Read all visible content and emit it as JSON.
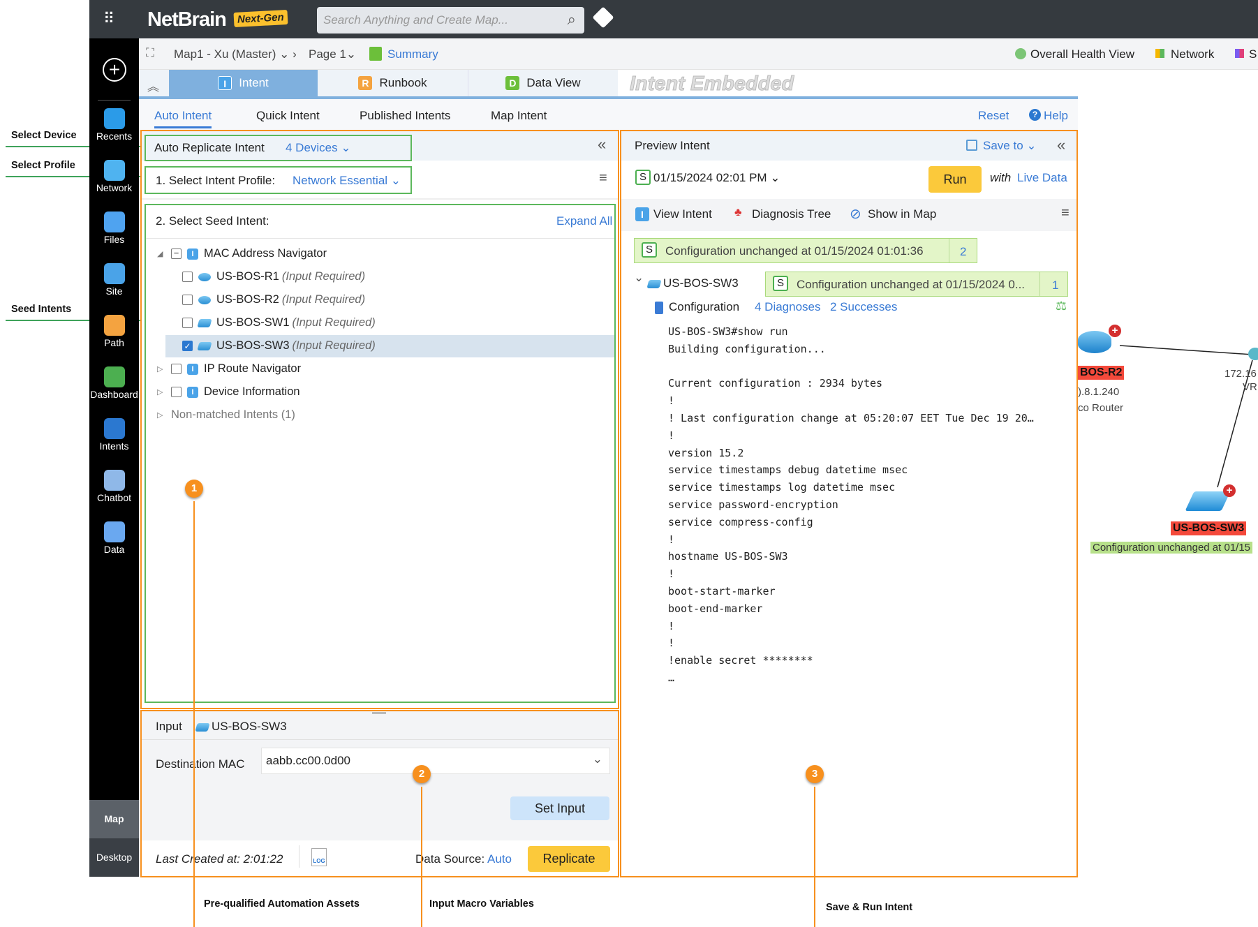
{
  "annotations": {
    "select_device": "Select Device",
    "select_profile": "Select Profile",
    "seed_intents": "Seed Intents",
    "assets": "Pre-qualified Automation Assets",
    "macros": "Input Macro Variables",
    "save_run": "Save & Run Intent",
    "n1": "1",
    "n2": "2",
    "n3": "3",
    "accent": "#f7901e"
  },
  "topbar": {
    "logo": "NetBrain",
    "logo_tag": "Next-Gen",
    "search_placeholder": "Search Anything and Create Map..."
  },
  "sidebar": {
    "items": [
      {
        "label": "Recents",
        "icon": "recents-icon"
      },
      {
        "label": "Network",
        "icon": "network-icon"
      },
      {
        "label": "Files",
        "icon": "files-icon"
      },
      {
        "label": "Site",
        "icon": "site-icon"
      },
      {
        "label": "Path",
        "icon": "path-icon"
      },
      {
        "label": "Dashboard",
        "icon": "dashboard-icon"
      },
      {
        "label": "Intents",
        "icon": "intents-icon"
      },
      {
        "label": "Chatbot",
        "icon": "chatbot-icon"
      },
      {
        "label": "Data",
        "icon": "data-icon"
      }
    ],
    "map": "Map",
    "desktop": "Desktop"
  },
  "breadcrumb": {
    "map": "Map1 - Xu (Master)",
    "page": "Page 1",
    "summary": "Summary",
    "right": [
      "Overall Health View",
      "Network",
      "S"
    ]
  },
  "tabs": {
    "intent": "Intent",
    "runbook": "Runbook",
    "dataview": "Data View",
    "embedded": "Intent Embedded"
  },
  "subtabs": {
    "items": [
      "Auto Intent",
      "Quick Intent",
      "Published Intents",
      "Map Intent"
    ],
    "active": 0,
    "reset": "Reset",
    "help": "Help"
  },
  "left": {
    "title": "Auto Replicate Intent",
    "devices": "4 Devices",
    "profile_label": "1. Select Intent Profile:",
    "profile": "Network Essential",
    "seed_label": "2. Select Seed Intent:",
    "expand": "Expand All",
    "tree": [
      {
        "label": "MAC Address Navigator",
        "level": 0,
        "expanded": true,
        "check": "partial"
      },
      {
        "label": "US-BOS-R1",
        "note": "(Input Required)",
        "level": 1,
        "check": "off",
        "dev": "router"
      },
      {
        "label": "US-BOS-R2",
        "note": "(Input Required)",
        "level": 1,
        "check": "off",
        "dev": "router"
      },
      {
        "label": "US-BOS-SW1",
        "note": "(Input Required)",
        "level": 1,
        "check": "off",
        "dev": "switch"
      },
      {
        "label": "US-BOS-SW3",
        "note": "(Input Required)",
        "level": 1,
        "check": "on",
        "dev": "switch",
        "selected": true
      },
      {
        "label": "IP Route Navigator",
        "level": 0,
        "check": "off"
      },
      {
        "label": "Device Information",
        "level": 0,
        "check": "off"
      },
      {
        "label": "Non-matched Intents (1)",
        "level": 0,
        "muted": true
      }
    ]
  },
  "input": {
    "title": "Input",
    "device": "US-BOS-SW3",
    "field_label": "Destination MAC",
    "field_value": "aabb.cc00.0d00",
    "set": "Set Input",
    "last_created": "Last Created at: 2:01:22",
    "source_label": "Data Source:",
    "source": "Auto",
    "replicate": "Replicate"
  },
  "preview": {
    "title": "Preview Intent",
    "save": "Save to",
    "date": "01/15/2024 02:01 PM",
    "run": "Run",
    "with": "with",
    "live": "Live Data",
    "view": "View Intent",
    "tree": "Diagnosis Tree",
    "show": "Show in Map",
    "status1": "Configuration unchanged at 01/15/2024 01:01:36",
    "count1": "2",
    "device": "US-BOS-SW3",
    "status2": "Configuration unchanged at 01/15/2024 0...",
    "count2": "1",
    "config": "Configuration",
    "diag": "4 Diagnoses",
    "succ": "2 Successes",
    "s": "S",
    "code": [
      "US-BOS-SW3#show run",
      "Building configuration...",
      "",
      "Current configuration : 2934 bytes",
      "!",
      "! Last configuration change at 05:20:07 EET Tue Dec 19 20…",
      "!",
      "version 15.2",
      "service timestamps debug datetime msec",
      "service timestamps log datetime msec",
      "service password-encryption",
      "service compress-config",
      "!",
      "hostname US-BOS-SW3",
      "!",
      "boot-start-marker",
      "boot-end-marker",
      "!",
      "!",
      "!enable secret ********",
      "…"
    ]
  },
  "map": {
    "r2": "BOS-R2",
    "r2_ip": ").8.1.240",
    "r2_type": "co Router",
    "peer_ip": "172.16",
    "peer_vrf": "VRF",
    "sw3": "US-BOS-SW3",
    "sw3_status": "Configuration unchanged at 01/15"
  }
}
